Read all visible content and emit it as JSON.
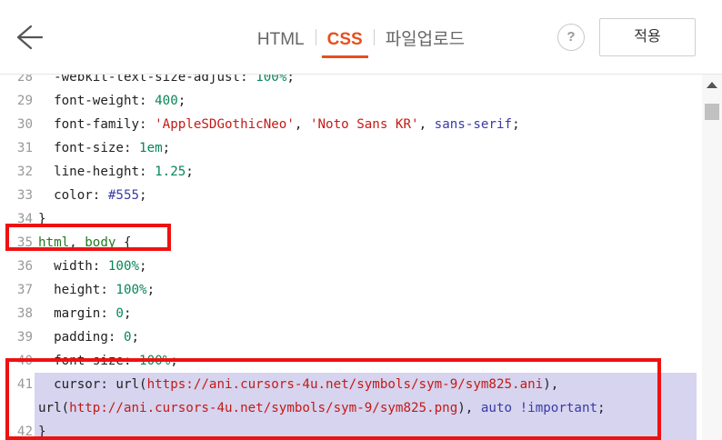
{
  "header": {
    "tabs": [
      {
        "label": "HTML",
        "active": false
      },
      {
        "label": "CSS",
        "active": true
      },
      {
        "label": "파일업로드",
        "active": false
      }
    ],
    "help_label": "?",
    "apply_label": "적용"
  },
  "colors": {
    "accent": "#e84f1c",
    "highlight_box": "#ee1111",
    "selection": "#d6d4ef"
  },
  "editor": {
    "lines": [
      {
        "n": "28",
        "segments": [
          {
            "t": "  -webkit-text-size-adjust: ",
            "c": "k"
          },
          {
            "t": "100%",
            "c": "num"
          },
          {
            "t": ";",
            "c": "k"
          }
        ]
      },
      {
        "n": "29",
        "segments": [
          {
            "t": "  font-weight: ",
            "c": "k"
          },
          {
            "t": "400",
            "c": "num"
          },
          {
            "t": ";",
            "c": "k"
          }
        ]
      },
      {
        "n": "30",
        "segments": [
          {
            "t": "  font-family: ",
            "c": "k"
          },
          {
            "t": "'AppleSDGothicNeo'",
            "c": "str"
          },
          {
            "t": ", ",
            "c": "k"
          },
          {
            "t": "'Noto Sans KR'",
            "c": "str"
          },
          {
            "t": ", ",
            "c": "k"
          },
          {
            "t": "sans-serif",
            "c": "kw"
          },
          {
            "t": ";",
            "c": "k"
          }
        ]
      },
      {
        "n": "31",
        "segments": [
          {
            "t": "  font-size: ",
            "c": "k"
          },
          {
            "t": "1em",
            "c": "num"
          },
          {
            "t": ";",
            "c": "k"
          }
        ]
      },
      {
        "n": "32",
        "segments": [
          {
            "t": "  line-height: ",
            "c": "k"
          },
          {
            "t": "1.25",
            "c": "num"
          },
          {
            "t": ";",
            "c": "k"
          }
        ]
      },
      {
        "n": "33",
        "segments": [
          {
            "t": "  color: ",
            "c": "k"
          },
          {
            "t": "#555",
            "c": "kw"
          },
          {
            "t": ";",
            "c": "k"
          }
        ]
      },
      {
        "n": "34",
        "segments": [
          {
            "t": "}",
            "c": "k"
          }
        ]
      },
      {
        "n": "35",
        "segments": [
          {
            "t": "html",
            "c": "sel-tag"
          },
          {
            "t": ", ",
            "c": "k"
          },
          {
            "t": "body",
            "c": "sel-tag"
          },
          {
            "t": " {",
            "c": "k"
          }
        ]
      },
      {
        "n": "36",
        "segments": [
          {
            "t": "  width: ",
            "c": "k"
          },
          {
            "t": "100%",
            "c": "num"
          },
          {
            "t": ";",
            "c": "k"
          }
        ]
      },
      {
        "n": "37",
        "segments": [
          {
            "t": "  height: ",
            "c": "k"
          },
          {
            "t": "100%",
            "c": "num"
          },
          {
            "t": ";",
            "c": "k"
          }
        ]
      },
      {
        "n": "38",
        "segments": [
          {
            "t": "  margin: ",
            "c": "k"
          },
          {
            "t": "0",
            "c": "num"
          },
          {
            "t": ";",
            "c": "k"
          }
        ]
      },
      {
        "n": "39",
        "segments": [
          {
            "t": "  padding: ",
            "c": "k"
          },
          {
            "t": "0",
            "c": "num"
          },
          {
            "t": ";",
            "c": "k"
          }
        ]
      },
      {
        "n": "40",
        "segments": [
          {
            "t": "  font-size: ",
            "c": "k"
          },
          {
            "t": "100%",
            "c": "num"
          },
          {
            "t": ";",
            "c": "k"
          }
        ]
      },
      {
        "n": "41",
        "selected": true,
        "segments": [
          {
            "t": "  cursor: url(",
            "c": "k"
          },
          {
            "t": "https://ani.cursors-4u.net/symbols/sym-9/sym825.ani",
            "c": "str"
          },
          {
            "t": "),",
            "c": "k"
          }
        ]
      },
      {
        "n": "",
        "selected": true,
        "segments": [
          {
            "t": "url(",
            "c": "k"
          },
          {
            "t": "http://ani.cursors-4u.net/symbols/sym-9/sym825.png",
            "c": "str"
          },
          {
            "t": "), ",
            "c": "k"
          },
          {
            "t": "auto",
            "c": "kw"
          },
          {
            "t": " ",
            "c": "k"
          },
          {
            "t": "!important",
            "c": "kw"
          },
          {
            "t": ";",
            "c": "k"
          }
        ]
      },
      {
        "n": "42",
        "selected": true,
        "segments": [
          {
            "t": "}",
            "c": "k"
          }
        ]
      }
    ]
  }
}
